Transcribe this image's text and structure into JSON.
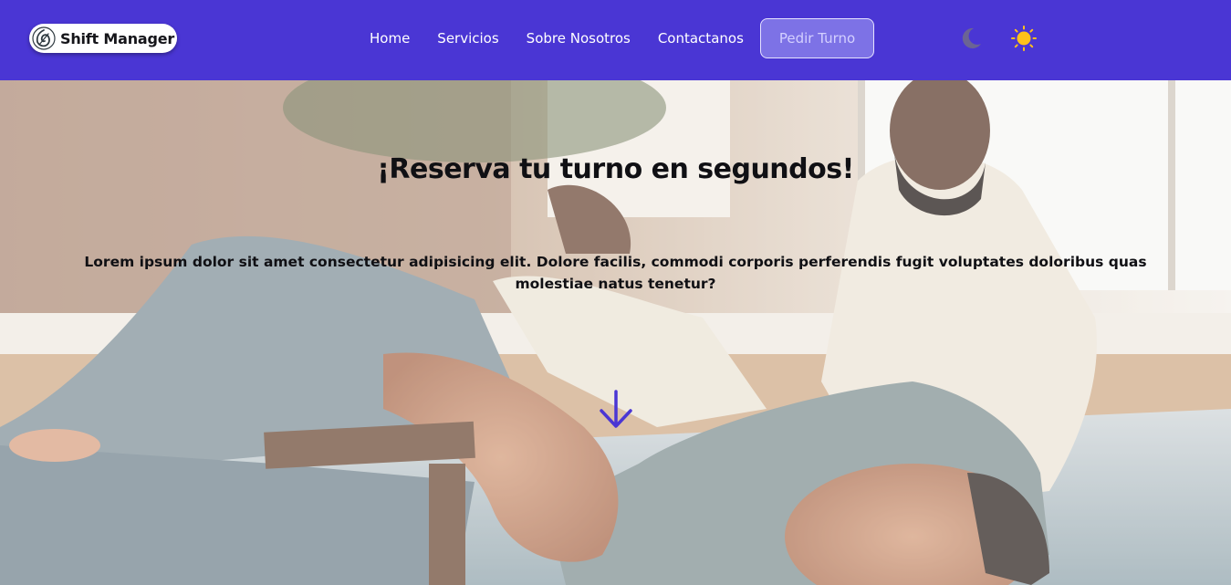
{
  "brand": {
    "name": "Shift Manager",
    "icon": "shield-leaf-logo-icon"
  },
  "nav": {
    "links": [
      {
        "label": "Home"
      },
      {
        "label": "Servicios"
      },
      {
        "label": "Sobre Nosotros"
      },
      {
        "label": "Contactanos"
      }
    ],
    "cta_label": "Pedir Turno"
  },
  "theme_toggle": {
    "dark_icon": "moon-icon",
    "light_icon": "sun-icon"
  },
  "hero": {
    "title": "¡Reserva tu turno en segundos!",
    "text": "Lorem ipsum dolor sit amet consectetur adipisicing elit. Dolore facilis, commodi corporis perferendis fugit voluptates doloribus quas molestiae natus tenetur?",
    "scroll_icon": "arrow-down-icon",
    "background": "jiu-jitsu-training-photo"
  },
  "colors": {
    "navbar": "#4a36d4",
    "cta_bg": "#7d72e6",
    "sun": "#ffc21a",
    "moon": "#6b6494",
    "arrow": "#4a36d4"
  }
}
